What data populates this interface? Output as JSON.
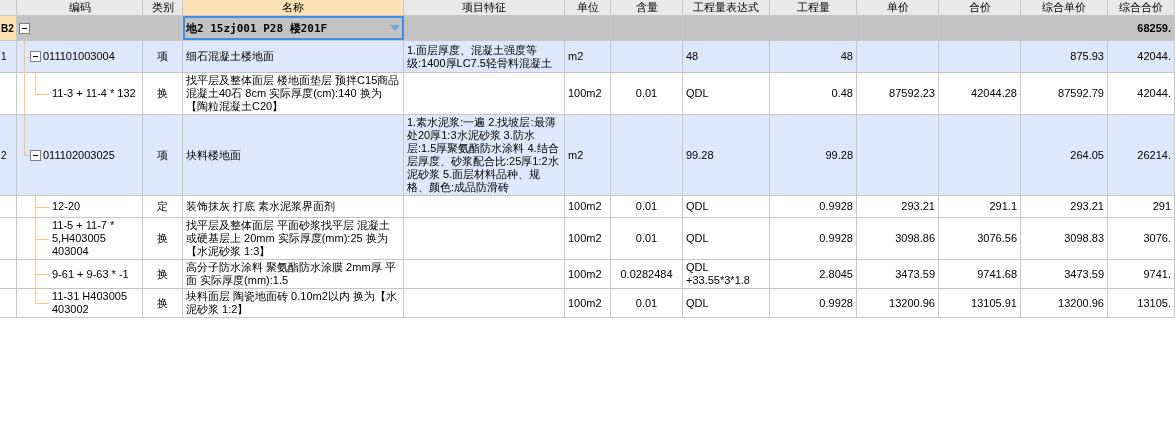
{
  "table": {
    "columns": [
      {
        "label": "编码",
        "selected": false
      },
      {
        "label": "类别",
        "selected": false
      },
      {
        "label": "名称",
        "selected": true
      },
      {
        "label": "项目特征",
        "selected": false
      },
      {
        "label": "单位",
        "selected": false
      },
      {
        "label": "含量",
        "selected": false
      },
      {
        "label": "工程量表达式",
        "selected": false
      },
      {
        "label": "工程量",
        "selected": false
      },
      {
        "label": "单价",
        "selected": false
      },
      {
        "label": "合价",
        "selected": false
      },
      {
        "label": "综合单价",
        "selected": false
      },
      {
        "label": "综合合价",
        "selected": false
      }
    ],
    "rows": [
      {
        "kind": "group",
        "number": "B2",
        "selected": true,
        "expanded": true,
        "name": "地2 15zj001 P28 楼201F",
        "comp_total": "68259.",
        "children": [
          {
            "kind": "item",
            "number": "1",
            "selected": false,
            "expanded": true,
            "code": "011101003004",
            "type": "项",
            "name": "细石混凝土楼地面",
            "features": "1.面层厚度、混凝土强度等级:1400厚LC7.5轻骨料混凝土",
            "unit": "m2",
            "expression": "48",
            "quantity": "48",
            "comp_unit_price": "875.93",
            "comp_total": "42044.",
            "children": [
              {
                "kind": "sub",
                "selected": false,
                "code": "11-3 + 11-4 * 132",
                "type": "换",
                "name": "找平层及整体面层 楼地面垫层 预拌C15商品混凝土40石 8cm  实际厚度(cm):140  换为【陶粒混凝土C20】",
                "unit": "100m2",
                "content": "0.01",
                "expression": "QDL",
                "quantity": "0.48",
                "unit_price": "87592.23",
                "total": "42044.28",
                "comp_unit_price": "87592.79",
                "comp_total": "42044."
              }
            ]
          },
          {
            "kind": "item",
            "number": "2",
            "selected": false,
            "expanded": true,
            "code": "011102003025",
            "type": "项",
            "name": "块料楼地面",
            "features": "1.素水泥浆:一遍 2.找坡层:最薄处20厚1:3水泥砂浆 3.防水层:1.5厚聚氨酯防水涂料 4.结合层厚度、砂浆配合比:25厚1:2水泥砂浆 5.面层材料品种、规格、颜色:成品防滑砖",
            "unit": "m2",
            "expression": "99.28",
            "quantity": "99.28",
            "comp_unit_price": "264.05",
            "comp_total": "26214.",
            "children": [
              {
                "kind": "sub",
                "selected": false,
                "code": "12-20",
                "type": "定",
                "name": "装饰抹灰 打底 素水泥浆界面剂",
                "unit": "100m2",
                "content": "0.01",
                "expression": "QDL",
                "quantity": "0.9928",
                "unit_price": "293.21",
                "total": "291.1",
                "comp_unit_price": "293.21",
                "comp_total": "291"
              },
              {
                "kind": "sub",
                "selected": false,
                "code": "11-5 + 11-7 * 5,H403005 403004",
                "type": "换",
                "name": "找平层及整体面层 平面砂浆找平层 混凝土或硬基层上 20mm  实际厚度(mm):25  换为【水泥砂浆 1:3】",
                "unit": "100m2",
                "content": "0.01",
                "expression": "QDL",
                "quantity": "0.9928",
                "unit_price": "3098.86",
                "total": "3076.56",
                "comp_unit_price": "3098.83",
                "comp_total": "3076."
              },
              {
                "kind": "sub",
                "selected": false,
                "code": "9-61 + 9-63 * -1",
                "type": "换",
                "name": "高分子防水涂料 聚氨酯防水涂膜 2mm厚 平面  实际厚度(mm):1.5",
                "unit": "100m2",
                "content": "0.0282484",
                "expression": "QDL +33.55*3*1.8",
                "quantity": "2.8045",
                "unit_price": "3473.59",
                "total": "9741.68",
                "comp_unit_price": "3473.59",
                "comp_total": "9741."
              },
              {
                "kind": "sub",
                "selected": false,
                "code": "11-31 H403005 403002",
                "type": "换",
                "name": "块料面层 陶瓷地面砖 0.10m2以内  换为【水泥砂浆 1:2】",
                "unit": "100m2",
                "content": "0.01",
                "expression": "QDL",
                "quantity": "0.9928",
                "unit_price": "13200.96",
                "total": "13105.91",
                "comp_unit_price": "13200.96",
                "comp_total": "13105."
              }
            ]
          }
        ]
      }
    ]
  }
}
